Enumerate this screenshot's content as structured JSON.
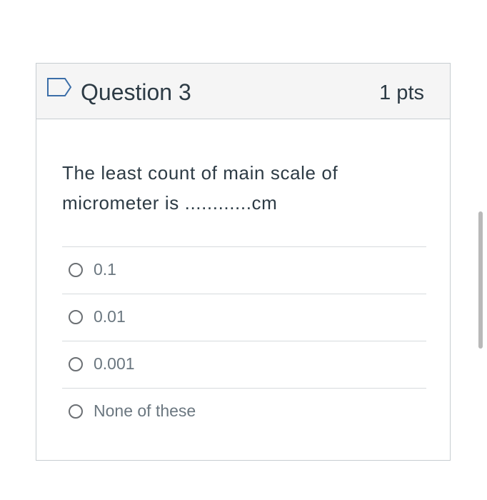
{
  "question": {
    "title": "Question 3",
    "points": "1 pts",
    "text": "The least count of main scale of micrometer is ............cm",
    "flag_icon": "flag-outline-icon"
  },
  "answers": [
    {
      "label": "0.1",
      "selected": false
    },
    {
      "label": "0.01",
      "selected": false
    },
    {
      "label": "0.001",
      "selected": false
    },
    {
      "label": "None of these",
      "selected": false
    }
  ],
  "colors": {
    "accent": "#2d3b45",
    "header_bg": "#f5f5f5",
    "border": "#c7cdd1",
    "flag": "#3b6ea8"
  }
}
